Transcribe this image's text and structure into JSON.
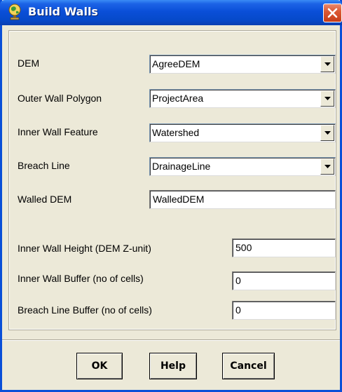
{
  "window": {
    "title": "Build Walls",
    "icon": "globe-icon",
    "close_icon": "close-icon"
  },
  "fields": {
    "dem": {
      "label": "DEM",
      "value": "AgreeDEM"
    },
    "outer_wall": {
      "label": "Outer Wall Polygon",
      "value": "ProjectArea"
    },
    "inner_wall_feature": {
      "label": "Inner Wall Feature",
      "value": "Watershed"
    },
    "breach_line": {
      "label": "Breach Line",
      "value": "DrainageLine"
    },
    "walled_dem": {
      "label": "Walled DEM",
      "value": "WalledDEM"
    },
    "inner_wall_height": {
      "label": "Inner Wall Height (DEM Z-unit)",
      "value": "500"
    },
    "inner_wall_buffer": {
      "label": "Inner Wall Buffer (no of cells)",
      "value": "0"
    },
    "breach_line_buffer": {
      "label": "Breach Line Buffer (no of cells)",
      "value": "0"
    }
  },
  "buttons": {
    "ok": "OK",
    "help": "Help",
    "cancel": "Cancel"
  },
  "colors": {
    "titlebar": "#0a4fd8",
    "dialog_bg": "#ece9d8",
    "close": "#dc5a35"
  }
}
